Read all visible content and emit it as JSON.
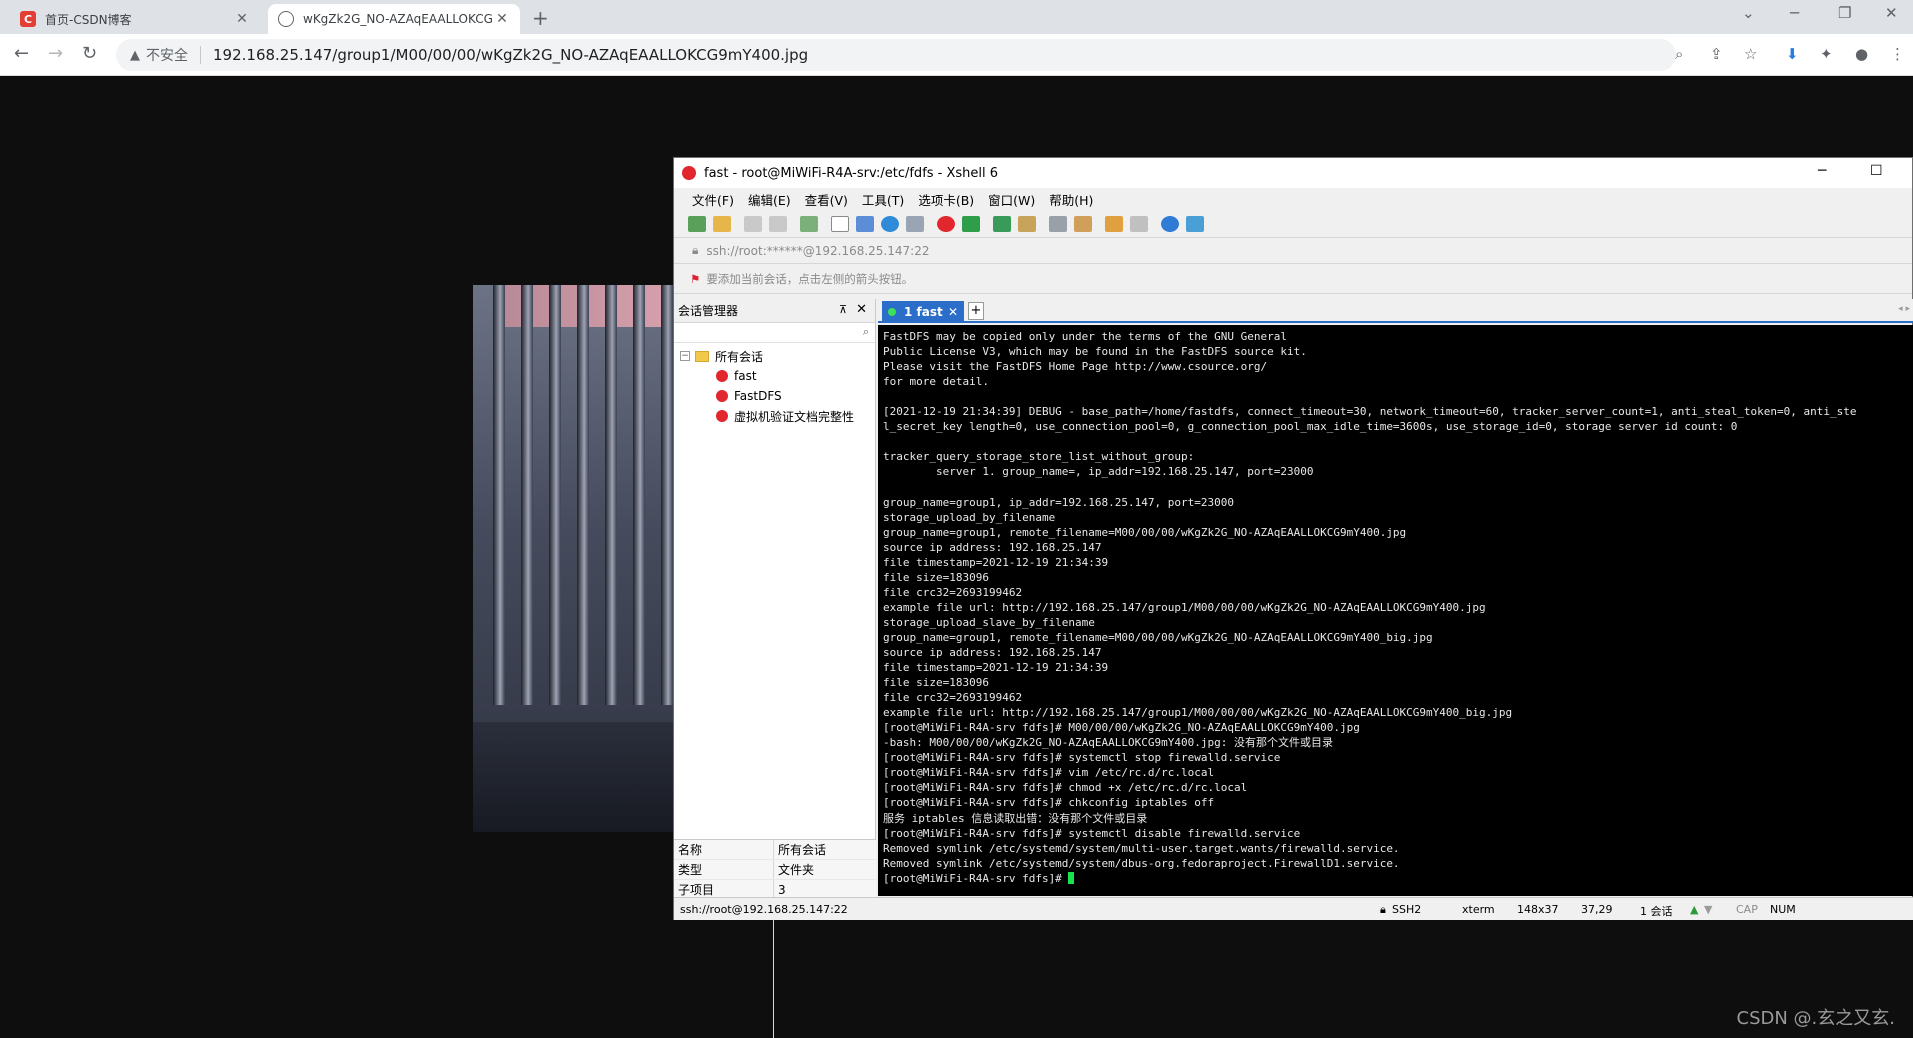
{
  "browser": {
    "tabs": [
      {
        "title": "首页-CSDN博客",
        "favicon": "csdn-icon"
      },
      {
        "title": "wKgZk2G_NO-AZAqEAALLOKCG",
        "favicon": "globe-icon"
      }
    ],
    "new_tab": "+",
    "window_controls": {
      "dropdown": "⌄",
      "minimize": "─",
      "restore": "❐",
      "close": "✕"
    },
    "nav": {
      "back": "←",
      "forward": "→",
      "reload": "↻"
    },
    "address": {
      "security_icon": "▲",
      "security_label": "不安全",
      "url": "192.168.25.147/group1/M00/00/00/wKgZk2G_NO-AZAqEAALLOKCG9mY400.jpg"
    },
    "toolbar_icons": {
      "zoom": "⌕",
      "share": "⇪",
      "bookmark": "☆",
      "ext1": "⬇",
      "extensions": "✦",
      "profile": "●",
      "menu": "⋮"
    }
  },
  "xshell": {
    "title": "fast - root@MiWiFi-R4A-srv:/etc/fdfs - Xshell 6",
    "controls": {
      "minimize": "─",
      "maximize": "☐"
    },
    "menu": [
      "文件(F)",
      "编辑(E)",
      "查看(V)",
      "工具(T)",
      "选项卡(B)",
      "窗口(W)",
      "帮助(H)"
    ],
    "address": "ssh://root:******@192.168.25.147:22",
    "hint": "要添加当前会话，点击左侧的箭头按钮。",
    "session_manager": {
      "title": "会话管理器",
      "pin": "⊼",
      "close": "✕",
      "root": "所有会话",
      "expander": "−",
      "sessions": [
        "fast",
        "FastDFS",
        "虚拟机验证文档完整性"
      ],
      "props": [
        {
          "k": "名称",
          "v": "所有会话"
        },
        {
          "k": "类型",
          "v": "文件夹"
        },
        {
          "k": "子项目",
          "v": "3"
        }
      ]
    },
    "tab": {
      "label": "1 fast",
      "close": "✕",
      "add": "+",
      "arrows": "◂ ▸"
    },
    "terminal": "FastDFS may be copied only under the terms of the GNU General\nPublic License V3, which may be found in the FastDFS source kit.\nPlease visit the FastDFS Home Page http://www.csource.org/\nfor more detail.\n\n[2021-12-19 21:34:39] DEBUG - base_path=/home/fastdfs, connect_timeout=30, network_timeout=60, tracker_server_count=1, anti_steal_token=0, anti_ste\nl_secret_key length=0, use_connection_pool=0, g_connection_pool_max_idle_time=3600s, use_storage_id=0, storage server id count: 0\n\ntracker_query_storage_store_list_without_group:\n        server 1. group_name=, ip_addr=192.168.25.147, port=23000\n\ngroup_name=group1, ip_addr=192.168.25.147, port=23000\nstorage_upload_by_filename\ngroup_name=group1, remote_filename=M00/00/00/wKgZk2G_NO-AZAqEAALLOKCG9mY400.jpg\nsource ip address: 192.168.25.147\nfile timestamp=2021-12-19 21:34:39\nfile size=183096\nfile crc32=2693199462\nexample file url: http://192.168.25.147/group1/M00/00/00/wKgZk2G_NO-AZAqEAALLOKCG9mY400.jpg\nstorage_upload_slave_by_filename\ngroup_name=group1, remote_filename=M00/00/00/wKgZk2G_NO-AZAqEAALLOKCG9mY400_big.jpg\nsource ip address: 192.168.25.147\nfile timestamp=2021-12-19 21:34:39\nfile size=183096\nfile crc32=2693199462\nexample file url: http://192.168.25.147/group1/M00/00/00/wKgZk2G_NO-AZAqEAALLOKCG9mY400_big.jpg\n[root@MiWiFi-R4A-srv fdfs]# M00/00/00/wKgZk2G_NO-AZAqEAALLOKCG9mY400.jpg\n-bash: M00/00/00/wKgZk2G_NO-AZAqEAALLOKCG9mY400.jpg: 没有那个文件或目录\n[root@MiWiFi-R4A-srv fdfs]# systemctl stop firewalld.service\n[root@MiWiFi-R4A-srv fdfs]# vim /etc/rc.d/rc.local\n[root@MiWiFi-R4A-srv fdfs]# chmod +x /etc/rc.d/rc.local\n[root@MiWiFi-R4A-srv fdfs]# chkconfig iptables off\n服务 iptables 信息读取出错：没有那个文件或目录\n[root@MiWiFi-R4A-srv fdfs]# systemctl disable firewalld.service\nRemoved symlink /etc/systemd/system/multi-user.target.wants/firewalld.service.\nRemoved symlink /etc/systemd/system/dbus-org.fedoraproject.FirewallD1.service.\n[root@MiWiFi-R4A-srv fdfs]# ",
    "status": {
      "left": "ssh://root@192.168.25.147:22",
      "protocol": "SSH2",
      "term": "xterm",
      "size": "148x37",
      "pos": "37,29",
      "sessions": "1 会话",
      "cap": "CAP",
      "num": "NUM"
    }
  },
  "watermark": "CSDN @.玄之又玄.",
  "colors": {
    "accent": "#2b6ec9",
    "terminal_bg": "#000000",
    "cursor": "#19e34c",
    "csdn": "#e33e33"
  }
}
